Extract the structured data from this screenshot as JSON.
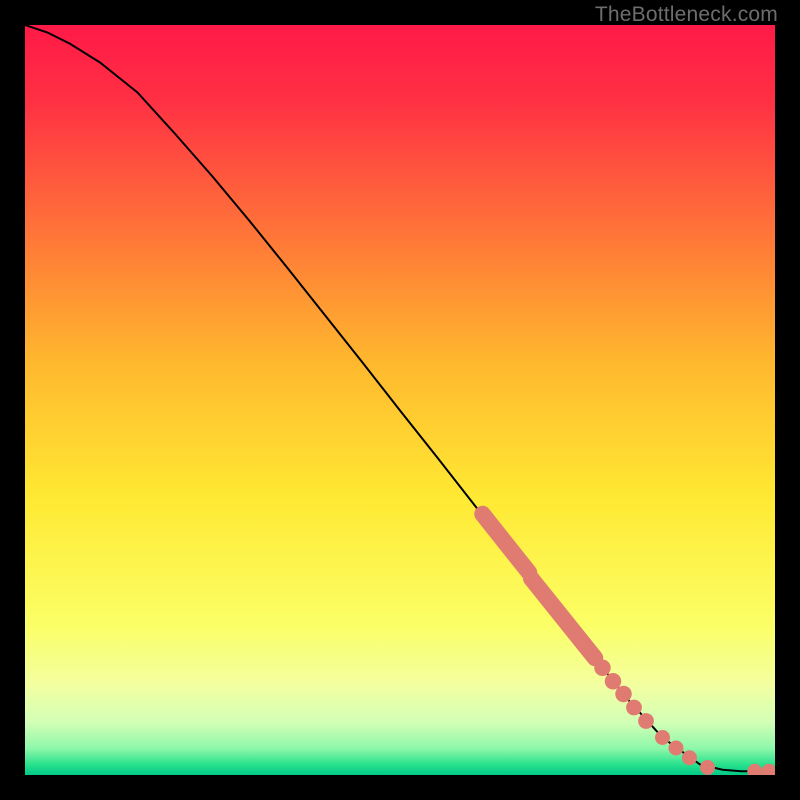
{
  "attribution": "TheBottleneck.com",
  "colors": {
    "background_black": "#000000",
    "curve": "#000000",
    "marker": "#e07b72",
    "gradient_stops": [
      {
        "offset": 0.0,
        "color": "#ff1a47"
      },
      {
        "offset": 0.1,
        "color": "#ff3044"
      },
      {
        "offset": 0.25,
        "color": "#ff6a3a"
      },
      {
        "offset": 0.45,
        "color": "#ffb82e"
      },
      {
        "offset": 0.63,
        "color": "#ffe933"
      },
      {
        "offset": 0.8,
        "color": "#fbff66"
      },
      {
        "offset": 0.88,
        "color": "#f3ffa0"
      },
      {
        "offset": 0.93,
        "color": "#d2ffb6"
      },
      {
        "offset": 0.965,
        "color": "#8cf7a9"
      },
      {
        "offset": 0.985,
        "color": "#2de38e"
      },
      {
        "offset": 1.0,
        "color": "#00c987"
      }
    ]
  },
  "chart_data": {
    "type": "line",
    "title": "",
    "xlabel": "",
    "ylabel": "",
    "xlim": [
      0,
      100
    ],
    "ylim": [
      0,
      100
    ],
    "series": [
      {
        "name": "curve",
        "x": [
          0,
          3,
          6,
          10,
          15,
          20,
          25,
          30,
          35,
          40,
          45,
          50,
          55,
          60,
          65,
          70,
          75,
          80,
          85,
          90,
          93,
          95.5,
          97,
          98,
          100
        ],
        "y": [
          100,
          99,
          97.5,
          95,
          91,
          85.5,
          79.8,
          73.8,
          67.6,
          61.3,
          55.0,
          48.6,
          42.3,
          35.9,
          29.6,
          23.2,
          16.9,
          10.5,
          5.0,
          1.4,
          0.7,
          0.5,
          0.5,
          0.5,
          0.5
        ]
      }
    ],
    "markers": [
      {
        "name": "cluster-a",
        "kind": "capsule",
        "x_start": 61.0,
        "y_start": 34.8,
        "x_end": 67.2,
        "y_end": 27.0,
        "radius": 1.1
      },
      {
        "name": "cluster-b",
        "kind": "capsule",
        "x_start": 67.5,
        "y_start": 26.2,
        "x_end": 76.0,
        "y_end": 15.6,
        "radius": 1.1
      },
      {
        "name": "pt-c1",
        "kind": "dot",
        "x": 77.0,
        "y": 14.3,
        "radius": 1.1
      },
      {
        "name": "pt-c2",
        "kind": "dot",
        "x": 78.4,
        "y": 12.5,
        "radius": 1.1
      },
      {
        "name": "pt-c3",
        "kind": "dot",
        "x": 79.8,
        "y": 10.8,
        "radius": 1.1
      },
      {
        "name": "pt-d1",
        "kind": "dot",
        "x": 81.2,
        "y": 9.0,
        "radius": 1.05
      },
      {
        "name": "pt-d2",
        "kind": "dot",
        "x": 82.8,
        "y": 7.2,
        "radius": 1.05
      },
      {
        "name": "pt-e1",
        "kind": "dot",
        "x": 85.0,
        "y": 5.0,
        "radius": 1.0
      },
      {
        "name": "pt-e2",
        "kind": "dot",
        "x": 86.8,
        "y": 3.6,
        "radius": 1.0
      },
      {
        "name": "pt-e3",
        "kind": "dot",
        "x": 88.6,
        "y": 2.3,
        "radius": 1.0
      },
      {
        "name": "pt-f1",
        "kind": "dot",
        "x": 91.0,
        "y": 1.0,
        "radius": 1.0
      },
      {
        "name": "pt-g1",
        "kind": "dot",
        "x": 97.3,
        "y": 0.5,
        "radius": 1.0
      },
      {
        "name": "pt-g2",
        "kind": "dot",
        "x": 99.2,
        "y": 0.5,
        "radius": 1.0
      }
    ]
  }
}
